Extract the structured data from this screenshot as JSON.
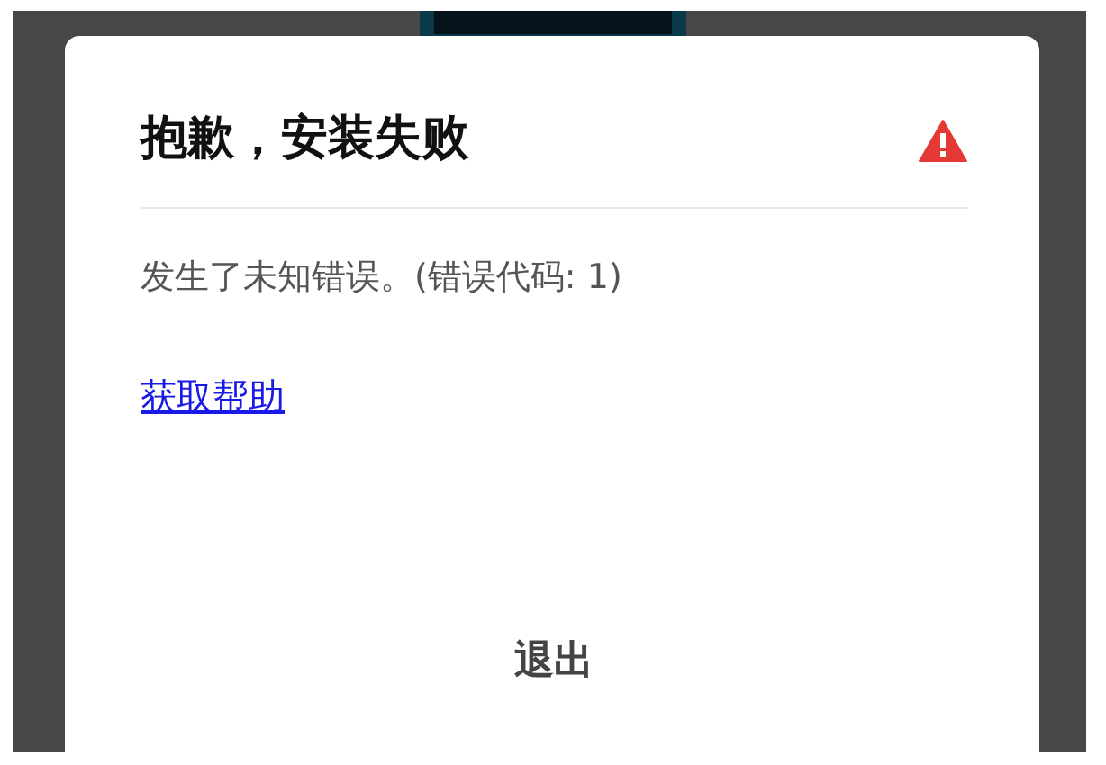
{
  "dialog": {
    "title": "抱歉，安装失败",
    "message": "发生了未知错误。(错误代码: 1)",
    "help_link": "获取帮助",
    "buttons": [
      "退出"
    ]
  }
}
